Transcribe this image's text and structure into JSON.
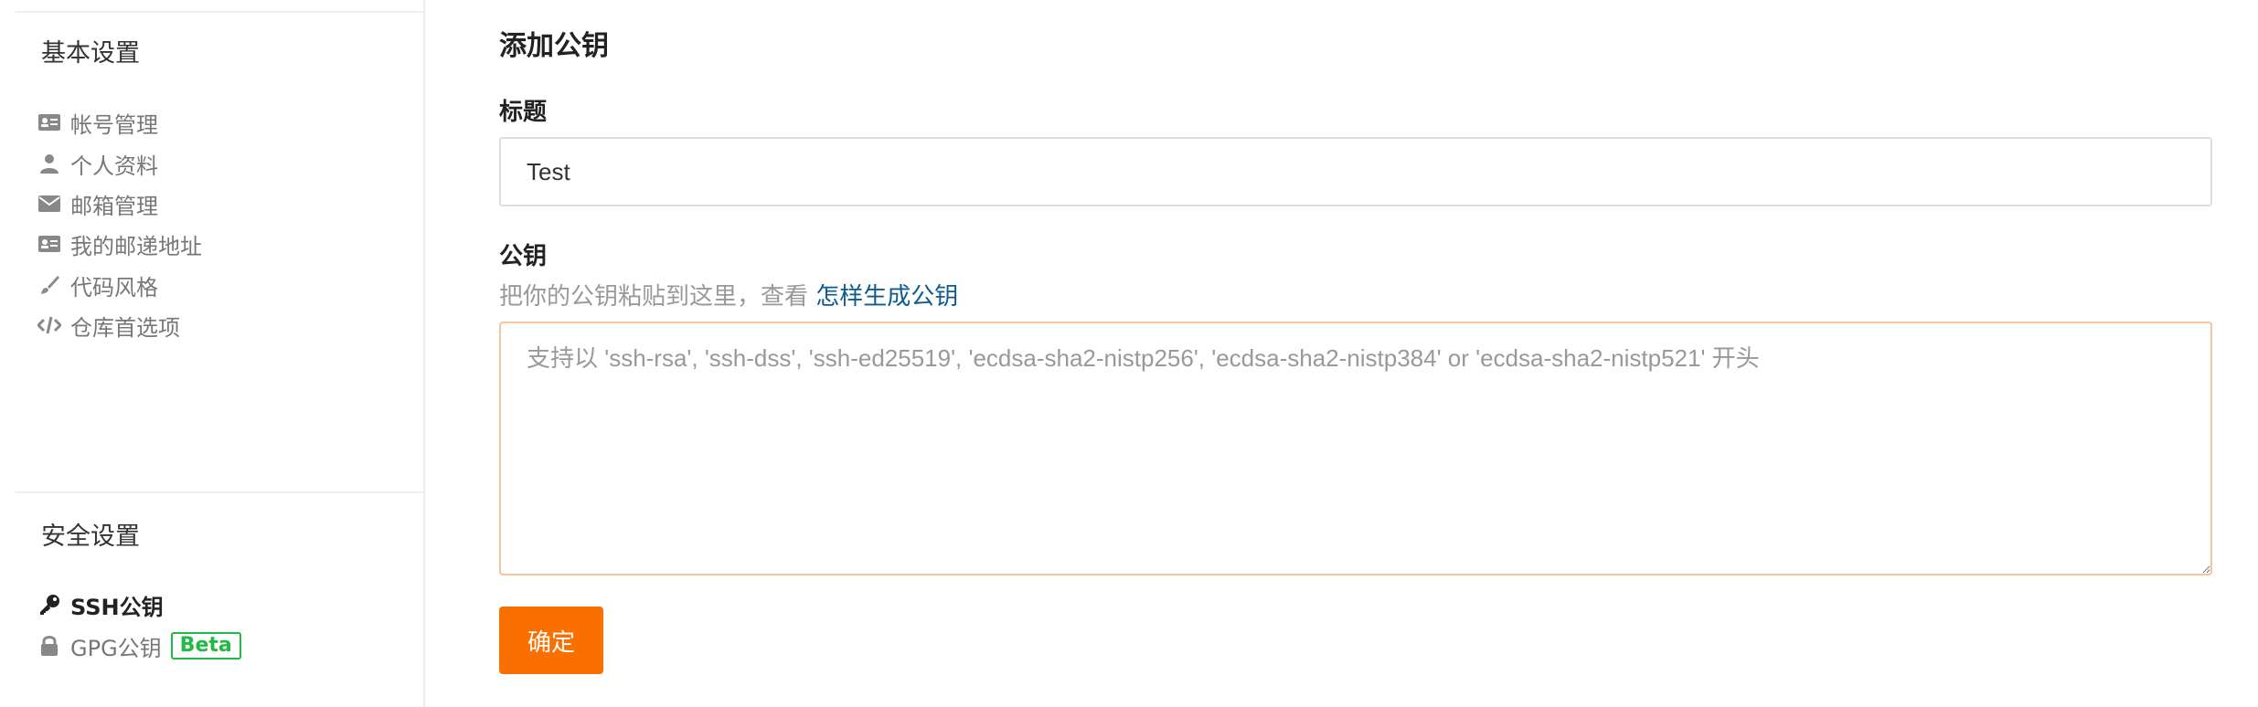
{
  "sidebar": {
    "basic_section_title": "基本设置",
    "basic_items": [
      {
        "label": "帐号管理",
        "icon": "id-card-icon"
      },
      {
        "label": "个人资料",
        "icon": "user-icon"
      },
      {
        "label": "邮箱管理",
        "icon": "envelope-icon"
      },
      {
        "label": "我的邮递地址",
        "icon": "address-card-icon"
      },
      {
        "label": "代码风格",
        "icon": "paintbrush-icon"
      },
      {
        "label": "仓库首选项",
        "icon": "code-icon"
      }
    ],
    "security_section_title": "安全设置",
    "security_items": [
      {
        "label": "SSH公钥",
        "icon": "key-icon",
        "active": true
      },
      {
        "label": "GPG公钥",
        "icon": "lock-icon",
        "badge": "Beta"
      }
    ]
  },
  "main": {
    "heading": "添加公钥",
    "title_label": "标题",
    "title_value": "Test",
    "key_label": "公钥",
    "help_text": "把你的公钥粘贴到这里，查看 ",
    "help_link": "怎样生成公钥",
    "key_placeholder": "支持以 'ssh-rsa', 'ssh-dss', 'ssh-ed25519', 'ecdsa-sha2-nistp256', 'ecdsa-sha2-nistp384' or 'ecdsa-sha2-nistp521' 开头",
    "confirm_label": "确定"
  },
  "colors": {
    "accent": "#fa7000",
    "link": "#0d5b8f",
    "badge_green": "#21ba45",
    "textarea_focus_border": "#f6c59e"
  }
}
